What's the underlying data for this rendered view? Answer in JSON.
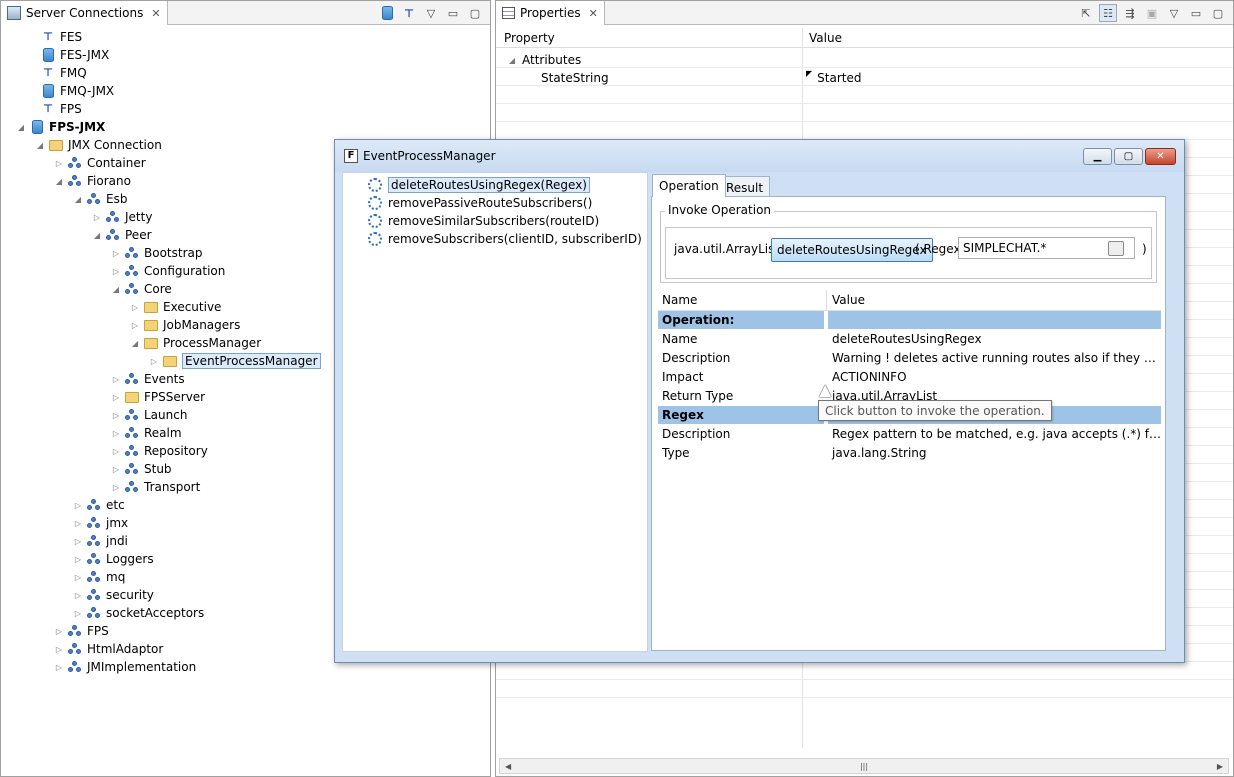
{
  "left_view": {
    "tab_title": "Server Connections",
    "tree": [
      {
        "label": "FES",
        "icon": "connection-icon"
      },
      {
        "label": "FES-JMX",
        "icon": "database-icon"
      },
      {
        "label": "FMQ",
        "icon": "connection-icon"
      },
      {
        "label": "FMQ-JMX",
        "icon": "database-icon"
      },
      {
        "label": "FPS",
        "icon": "connection-icon"
      },
      {
        "label": "FPS-JMX",
        "icon": "database-icon",
        "state": "expanded",
        "bold": true
      },
      {
        "label": "JMX Connection",
        "icon": "folder-jmx-icon",
        "state": "expanded"
      },
      {
        "label": "Container",
        "icon": "mbean-domain-icon",
        "state": "collapsed"
      },
      {
        "label": "Fiorano",
        "icon": "mbean-domain-icon",
        "state": "expanded"
      },
      {
        "label": "Esb",
        "icon": "mbean-domain-icon",
        "state": "expanded"
      },
      {
        "label": "Jetty",
        "icon": "mbean-domain-icon",
        "state": "collapsed"
      },
      {
        "label": "Peer",
        "icon": "mbean-domain-icon",
        "state": "expanded"
      },
      {
        "label": "Bootstrap",
        "icon": "mbean-domain-icon",
        "state": "collapsed"
      },
      {
        "label": "Configuration",
        "icon": "mbean-domain-icon",
        "state": "collapsed"
      },
      {
        "label": "Core",
        "icon": "mbean-domain-icon",
        "state": "expanded"
      },
      {
        "label": "Executive",
        "icon": "folder-icon",
        "state": "collapsed"
      },
      {
        "label": "JobManagers",
        "icon": "folder-icon",
        "state": "collapsed"
      },
      {
        "label": "ProcessManager",
        "icon": "folder-icon",
        "state": "expanded"
      },
      {
        "label": "EventProcessManager",
        "icon": "folder-icon",
        "state": "collapsed",
        "selected": true
      },
      {
        "label": "Events",
        "icon": "mbean-domain-icon",
        "state": "collapsed"
      },
      {
        "label": "FPSServer",
        "icon": "folder-icon",
        "state": "collapsed"
      },
      {
        "label": "Launch",
        "icon": "mbean-domain-icon",
        "state": "collapsed"
      },
      {
        "label": "Realm",
        "icon": "mbean-domain-icon",
        "state": "collapsed"
      },
      {
        "label": "Repository",
        "icon": "mbean-domain-icon",
        "state": "collapsed"
      },
      {
        "label": "Stub",
        "icon": "mbean-domain-icon",
        "state": "collapsed"
      },
      {
        "label": "Transport",
        "icon": "mbean-domain-icon",
        "state": "collapsed"
      },
      {
        "label": "etc",
        "icon": "mbean-domain-icon",
        "state": "collapsed"
      },
      {
        "label": "jmx",
        "icon": "mbean-domain-icon",
        "state": "collapsed"
      },
      {
        "label": "jndi",
        "icon": "mbean-domain-icon",
        "state": "collapsed"
      },
      {
        "label": "Loggers",
        "icon": "mbean-domain-icon",
        "state": "collapsed"
      },
      {
        "label": "mq",
        "icon": "mbean-domain-icon",
        "state": "collapsed"
      },
      {
        "label": "security",
        "icon": "mbean-domain-icon",
        "state": "collapsed"
      },
      {
        "label": "socketAcceptors",
        "icon": "mbean-domain-icon",
        "state": "collapsed"
      },
      {
        "label": "FPS",
        "icon": "mbean-domain-icon",
        "state": "collapsed"
      },
      {
        "label": "HtmlAdaptor",
        "icon": "mbean-domain-icon",
        "state": "collapsed"
      },
      {
        "label": "JMImplementation",
        "icon": "mbean-domain-icon",
        "state": "collapsed"
      }
    ]
  },
  "properties_view": {
    "tab_title": "Properties",
    "col_property": "Property",
    "col_value": "Value",
    "group": "Attributes",
    "rows": [
      {
        "property": "StateString",
        "value": "Started"
      }
    ]
  },
  "dialog": {
    "title": "EventProcessManager",
    "operations": [
      {
        "label": "deleteRoutesUsingRegex(Regex)",
        "selected": true
      },
      {
        "label": "removePassiveRouteSubscribers()"
      },
      {
        "label": "removeSimilarSubscribers(routeID)"
      },
      {
        "label": "removeSubscribers(clientID, subscriberID)"
      }
    ],
    "tabs": {
      "operation": "Operation",
      "result": "Result"
    },
    "invoke": {
      "group_title": "Invoke Operation",
      "return_type": "java.util.ArrayList",
      "button": "deleteRoutesUsingRegex",
      "open_paren": "( Regex",
      "regex_value": "SIMPLECHAT.*",
      "close_paren": ")",
      "tooltip": "Click button to invoke the operation."
    },
    "info": {
      "col_name": "Name",
      "col_value": "Value",
      "rows": [
        {
          "section": true,
          "name": "Operation:",
          "value": ""
        },
        {
          "name": "Name",
          "value": "deleteRoutesUsingRegex"
        },
        {
          "name": "Description",
          "value": "Warning ! deletes active running routes also if they match t..."
        },
        {
          "name": "Impact",
          "value": "ACTIONINFO"
        },
        {
          "name": "Return Type",
          "value": "java.util.ArrayList"
        },
        {
          "section": true,
          "name": "Regex",
          "value": ""
        },
        {
          "name": "Description",
          "value": "Regex pattern to be matched, e.g. java accepts (.*) for varia..."
        },
        {
          "name": "Type",
          "value": "java.lang.String"
        }
      ]
    }
  }
}
